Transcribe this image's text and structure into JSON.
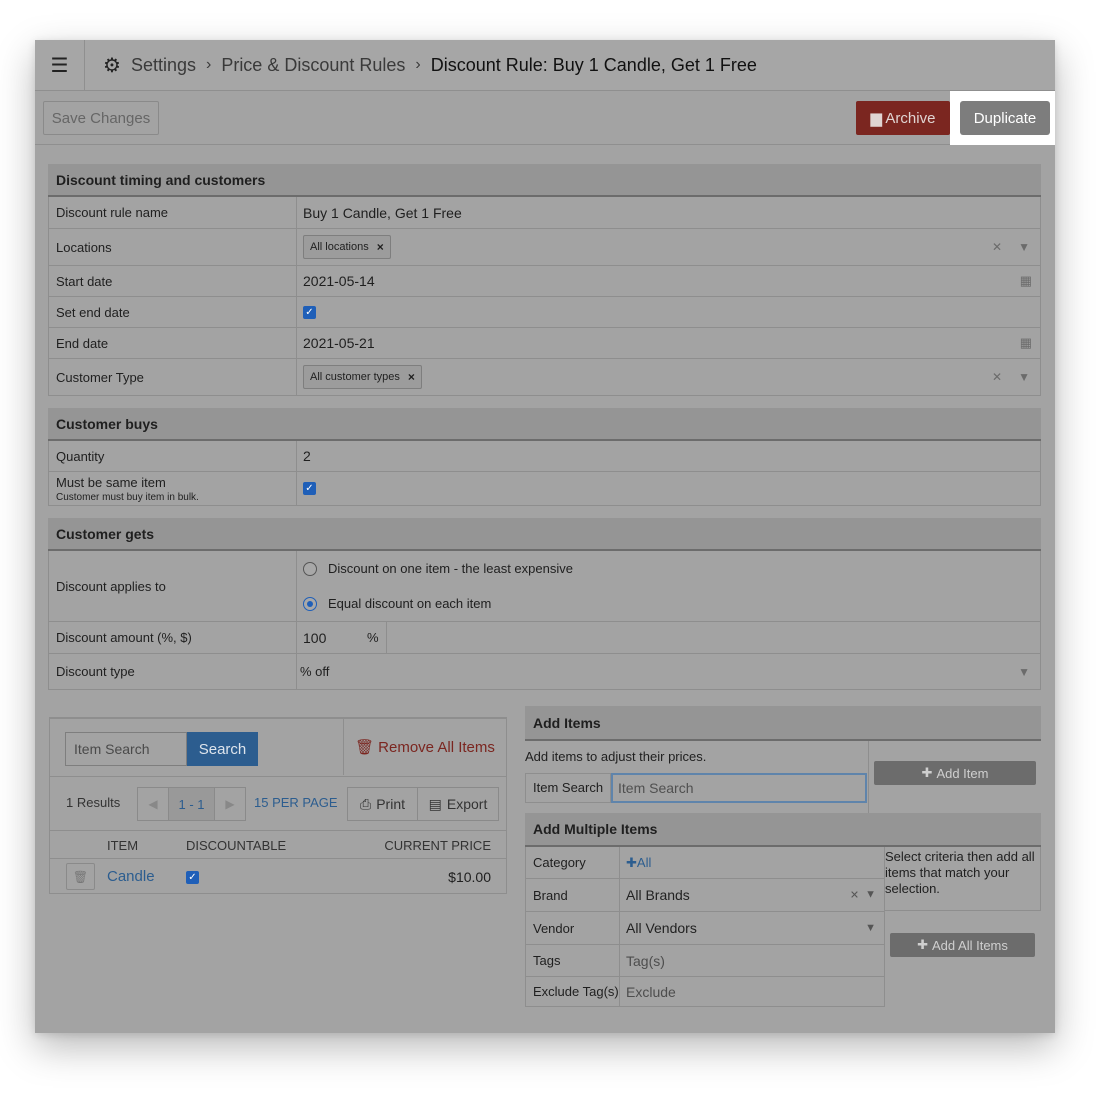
{
  "header": {
    "crumbs": [
      "Settings",
      "Price & Discount Rules"
    ],
    "current": "Discount Rule:  Buy 1 Candle, Get 1 Free"
  },
  "toolbar": {
    "save_label": "Save Changes",
    "archive_label": "Archive",
    "duplicate_label": "Duplicate"
  },
  "timing": {
    "title": "Discount timing and customers",
    "name_label": "Discount rule name",
    "name_value": "Buy 1 Candle, Get 1 Free",
    "locations_label": "Locations",
    "locations_tag": "All locations",
    "start_label": "Start date",
    "start_value": "2021-05-14",
    "set_end_label": "Set end date",
    "set_end_checked": true,
    "end_label": "End date",
    "end_value": "2021-05-21",
    "customer_type_label": "Customer Type",
    "customer_type_tag": "All customer types"
  },
  "buys": {
    "title": "Customer buys",
    "quantity_label": "Quantity",
    "quantity_value": "2",
    "same_item_label": "Must be same item",
    "same_item_hint": "Customer must buy item in bulk.",
    "same_item_checked": true
  },
  "gets": {
    "title": "Customer gets",
    "applies_label": "Discount applies to",
    "option_one": "Discount on one item - the least expensive",
    "option_two": "Equal discount on each item",
    "selected_option": "Equal discount on each item",
    "amount_label": "Discount amount (%, $)",
    "amount_value": "100",
    "amount_unit": "%",
    "type_label": "Discount type",
    "type_value": "% off"
  },
  "items_table": {
    "search_placeholder": "Item Search",
    "search_button": "Search",
    "remove_all": "Remove All Items",
    "results": "1 Results",
    "page": "1 - 1",
    "per_page": "15 PER PAGE",
    "print": "Print",
    "export": "Export",
    "columns": [
      "ITEM",
      "DISCOUNTABLE",
      "CURRENT PRICE"
    ],
    "rows": [
      {
        "item": "Candle",
        "discountable": true,
        "price": "$10.00"
      }
    ]
  },
  "add_items": {
    "title": "Add Items",
    "description": "Add items to adjust their prices.",
    "search_label": "Item Search",
    "search_placeholder": "Item Search",
    "add_button": "Add Item"
  },
  "add_multiple": {
    "title": "Add Multiple Items",
    "category_label": "Category",
    "category_value": "All",
    "brand_label": "Brand",
    "brand_value": "All Brands",
    "vendor_label": "Vendor",
    "vendor_value": "All Vendors",
    "tags_label": "Tags",
    "tags_placeholder": "Tag(s)",
    "exclude_label": "Exclude Tag(s)",
    "exclude_placeholder": "Exclude",
    "note": "Select criteria then add all items that match your selection.",
    "add_all_button": "Add All Items"
  },
  "colors": {
    "overlay_gray": "#a3a3a3",
    "archive_red": "#7b2620",
    "link_blue": "#2c5d8f",
    "checkbox_blue": "#1f5fb8"
  },
  "icons": [
    "menu-icon",
    "gear-icon",
    "chevron-right-icon",
    "archive-icon",
    "close-icon",
    "caret-down-icon",
    "calendar-icon",
    "trash-icon",
    "print-icon",
    "export-icon",
    "plus-icon"
  ]
}
